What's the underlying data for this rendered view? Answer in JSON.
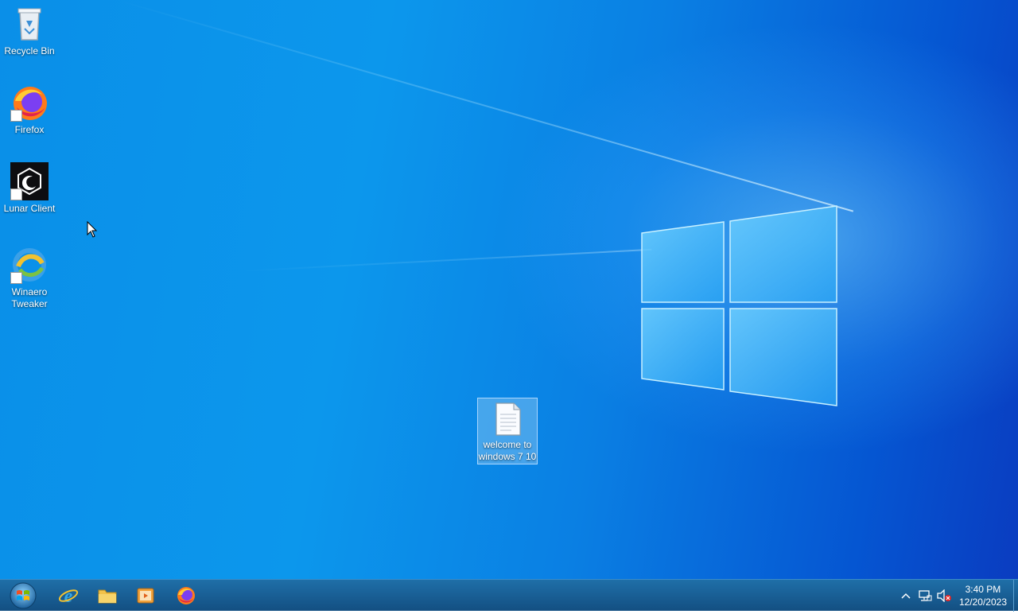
{
  "desktop": {
    "icons": [
      {
        "label": "Recycle Bin"
      },
      {
        "label": "Firefox"
      },
      {
        "label": "Lunar Client"
      },
      {
        "label": "Winaero Tweaker"
      },
      {
        "label": "welcome to windows 7 10"
      }
    ]
  },
  "taskbar": {
    "pinned": [
      "internet-explorer-icon",
      "file-explorer-icon",
      "media-player-icon",
      "firefox-icon"
    ],
    "clock": {
      "time": "3:40 PM",
      "date": "12/20/2023"
    }
  },
  "colors": {
    "taskbar": "#1a5f95",
    "desktop_accent": "#0a8fe8"
  }
}
